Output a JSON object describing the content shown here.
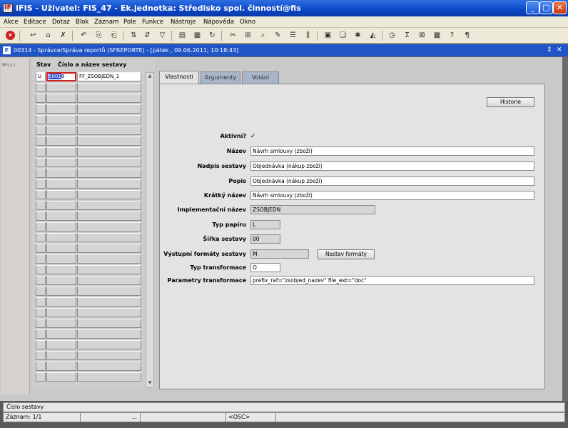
{
  "window": {
    "title": "IFIS - Uživatel: FIS_47 - Ek.jednotka: Středisko spol. činností@fis",
    "app_icon": "IF",
    "min": "_",
    "max": "□",
    "close": "✕"
  },
  "menu": [
    "Akce",
    "Editace",
    "Dotaz",
    "Blok",
    "Záznam",
    "Pole",
    "Funkce",
    "Nástroje",
    "Nápověda",
    "Okno"
  ],
  "form": {
    "title": "00314 - Správce/Správa reportů (SFREPORTE) - [pátek , 09.06.2011; 10:18:43]",
    "icon": "F",
    "ctl_restore": "⇕",
    "ctl_close": "✕"
  },
  "left": {
    "nav_label": "Nav"
  },
  "grid": {
    "col_stav": "Stav",
    "col_name": "Číslo a název sestavy",
    "active_row": {
      "stav": "U",
      "num_sel": "5001",
      "num_rest": "8",
      "name": "FF_ZSOBJEDN_1"
    }
  },
  "tabs": [
    "Vlastnosti",
    "Argumenty",
    "Volání"
  ],
  "panel": {
    "historie": "Historie",
    "aktivni_label": "Aktivní?",
    "aktivni_value": "✓",
    "nazev_label": "Název",
    "nazev_value": "Návrh smlouvy (zboží)",
    "nadpis_label": "Nadpis sestavy",
    "nadpis_value": "Objednávka (nákup zboží)",
    "popis_label": "Popis",
    "popis_value": "Objednávka (nákup zboží)",
    "kratky_label": "Krátký název",
    "kratky_value": "Návrh smlouvy (zboží)",
    "impl_label": "Implementační název",
    "impl_value": "ZSOBJEDN",
    "papir_label": "Typ papíru",
    "papir_value": "L",
    "sirka_label": "Šířka sestavy",
    "sirka_value": "00",
    "formaty_label": "Výstupní formáty sestavy",
    "formaty_value": "M",
    "nastav_button": "Nastav formáty",
    "transf_label": "Typ transformace",
    "transf_value": "O",
    "param_label": "Parametry transformace",
    "param_value": "prefix_raf=\"zsobjed_nazev\" file_ext=\"doc\""
  },
  "status": {
    "hint": "Číslo sestavy",
    "record": "Záznam: 1/1",
    "dots": "...",
    "osc": "<OSC>"
  }
}
